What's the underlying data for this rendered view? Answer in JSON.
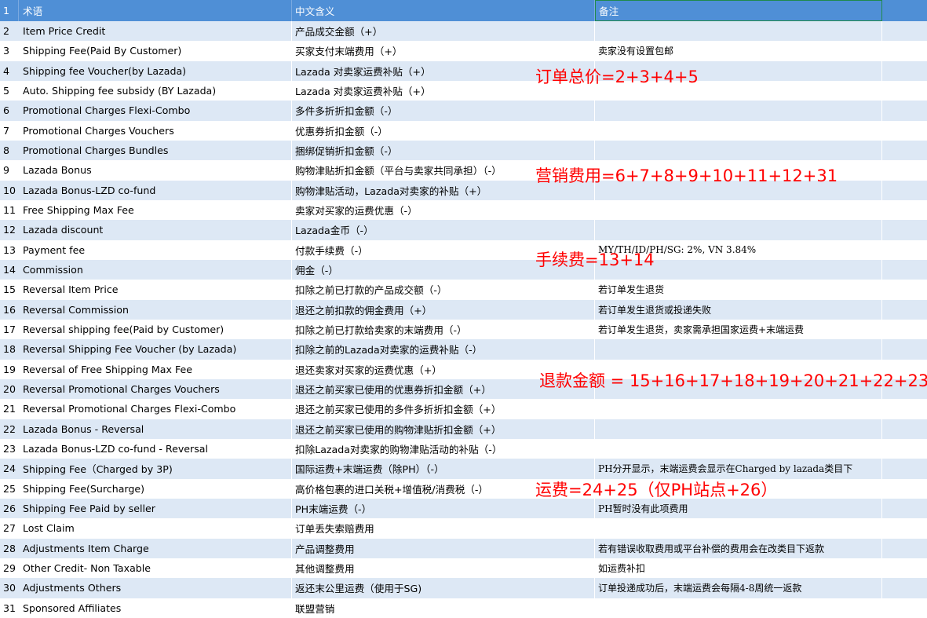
{
  "header": {
    "row_num": "1",
    "term": "术语",
    "cn": "中文含义",
    "note": "备注"
  },
  "rows": [
    {
      "num": "2",
      "term": "Item Price Credit",
      "cn": "产品成交金额（+）",
      "note": ""
    },
    {
      "num": "3",
      "term": "Shipping Fee(Paid By Customer)",
      "cn": "买家支付末端费用（+）",
      "note": "卖家没有设置包邮"
    },
    {
      "num": "4",
      "term": "Shipping fee Voucher(by Lazada)",
      "cn": "Lazada 对卖家运费补贴（+）",
      "note": ""
    },
    {
      "num": "5",
      "term": "Auto. Shipping fee subsidy (BY Lazada)",
      "cn": "Lazada 对卖家运费补贴（+）",
      "note": ""
    },
    {
      "num": "6",
      "term": "Promotional Charges Flexi-Combo",
      "cn": "多件多折折扣金额（-）",
      "note": ""
    },
    {
      "num": "7",
      "term": "Promotional Charges Vouchers",
      "cn": "优惠券折扣金额（-）",
      "note": ""
    },
    {
      "num": "8",
      "term": "Promotional Charges Bundles",
      "cn": "捆绑促销折扣金额（-）",
      "note": ""
    },
    {
      "num": "9",
      "term": "Lazada Bonus",
      "cn": "购物津贴折扣金额（平台与卖家共同承担）（-）",
      "note": ""
    },
    {
      "num": "10",
      "term": "Lazada Bonus-LZD co-fund",
      "cn": "购物津贴活动，Lazada对卖家的补贴（+）",
      "note": ""
    },
    {
      "num": "11",
      "term": "Free Shipping Max Fee",
      "cn": "卖家对买家的运费优惠（-）",
      "note": ""
    },
    {
      "num": "12",
      "term": "Lazada discount",
      "cn": "Lazada金币（-）",
      "note": ""
    },
    {
      "num": "13",
      "term": "Payment fee",
      "cn": "付款手续费（-）",
      "note": "MY/TH/ID/PH/SG: 2%, VN 3.84%"
    },
    {
      "num": "14",
      "term": "Commission",
      "cn": "佣金（-）",
      "note": ""
    },
    {
      "num": "15",
      "term": "Reversal Item Price",
      "cn": "扣除之前已打款的产品成交额（-）",
      "note": "若订单发生退货"
    },
    {
      "num": "16",
      "term": "Reversal Commission",
      "cn": "退还之前扣款的佣金费用（+）",
      "note": "若订单发生退货或投递失败"
    },
    {
      "num": "17",
      "term": "Reversal shipping fee(Paid by Customer)",
      "cn": "扣除之前已打款给卖家的末端费用（-）",
      "note": "若订单发生退货，卖家需承担国家运费+末端运费"
    },
    {
      "num": "18",
      "term": "Reversal Shipping Fee Voucher (by Lazada)",
      "cn": "扣除之前的Lazada对卖家的运费补贴（-）",
      "note": ""
    },
    {
      "num": "19",
      "term": "Reversal of Free Shipping Max Fee",
      "cn": "退还卖家对买家的运费优惠（+）",
      "note": ""
    },
    {
      "num": "20",
      "term": "Reversal Promotional Charges Vouchers",
      "cn": "退还之前买家已使用的优惠券折扣金额（+）",
      "note": ""
    },
    {
      "num": "21",
      "term": "Reversal Promotional Charges Flexi-Combo",
      "cn": "退还之前买家已使用的多件多折折扣金额（+）",
      "note": ""
    },
    {
      "num": "22",
      "term": "Lazada Bonus - Reversal",
      "cn": "退还之前买家已使用的购物津贴折扣金额（+）",
      "note": ""
    },
    {
      "num": "23",
      "term": "Lazada Bonus-LZD co-fund - Reversal",
      "cn": "扣除Lazada对卖家的购物津贴活动的补贴（-）",
      "note": ""
    },
    {
      "num": "24",
      "term": "Shipping Fee（Charged by 3P)",
      "cn": "国际运费+末端运费（除PH）（-）",
      "note": "PH分开显示，末端运费会显示在Charged by lazada类目下"
    },
    {
      "num": "25",
      "term": "Shipping Fee(Surcharge)",
      "cn": "高价格包裹的进口关税+增值税/消费税（-）",
      "note": ""
    },
    {
      "num": "26",
      "term": "Shipping Fee Paid by seller",
      "cn": "PH末端运费（-）",
      "note": "PH暂时没有此项费用"
    },
    {
      "num": "27",
      "term": "Lost Claim",
      "cn": "订单丢失索赔费用",
      "note": ""
    },
    {
      "num": "28",
      "term": "Adjustments Item Charge",
      "cn": "产品调整费用",
      "note": "若有错误收取费用或平台补偿的费用会在改类目下返款"
    },
    {
      "num": "29",
      "term": "Other Credit- Non Taxable",
      "cn": "其他调整费用",
      "note": "如运费补扣"
    },
    {
      "num": "30",
      "term": "Adjustments Others",
      "cn": "返还末公里运费（使用于SG)",
      "note": "订单投递成功后，末端运费会每隔4-8周统一返款"
    },
    {
      "num": "31",
      "term": "Sponsored Affiliates",
      "cn": "联盟营销",
      "note": ""
    }
  ],
  "annotations": [
    "订单总价=2+3+4+5",
    "营销费用=6+7+8+9+10+11+12+31",
    "手续费=13+14",
    "退款金额 = 15+16+17+18+19+20+21+22+23",
    "运费=24+25（仅PH站点+26）"
  ],
  "colors": {
    "header_bg": "#4f8fd6",
    "band_bg": "#dde8f5",
    "annotation": "#ff0000",
    "selection_border": "#1f8a4c"
  }
}
